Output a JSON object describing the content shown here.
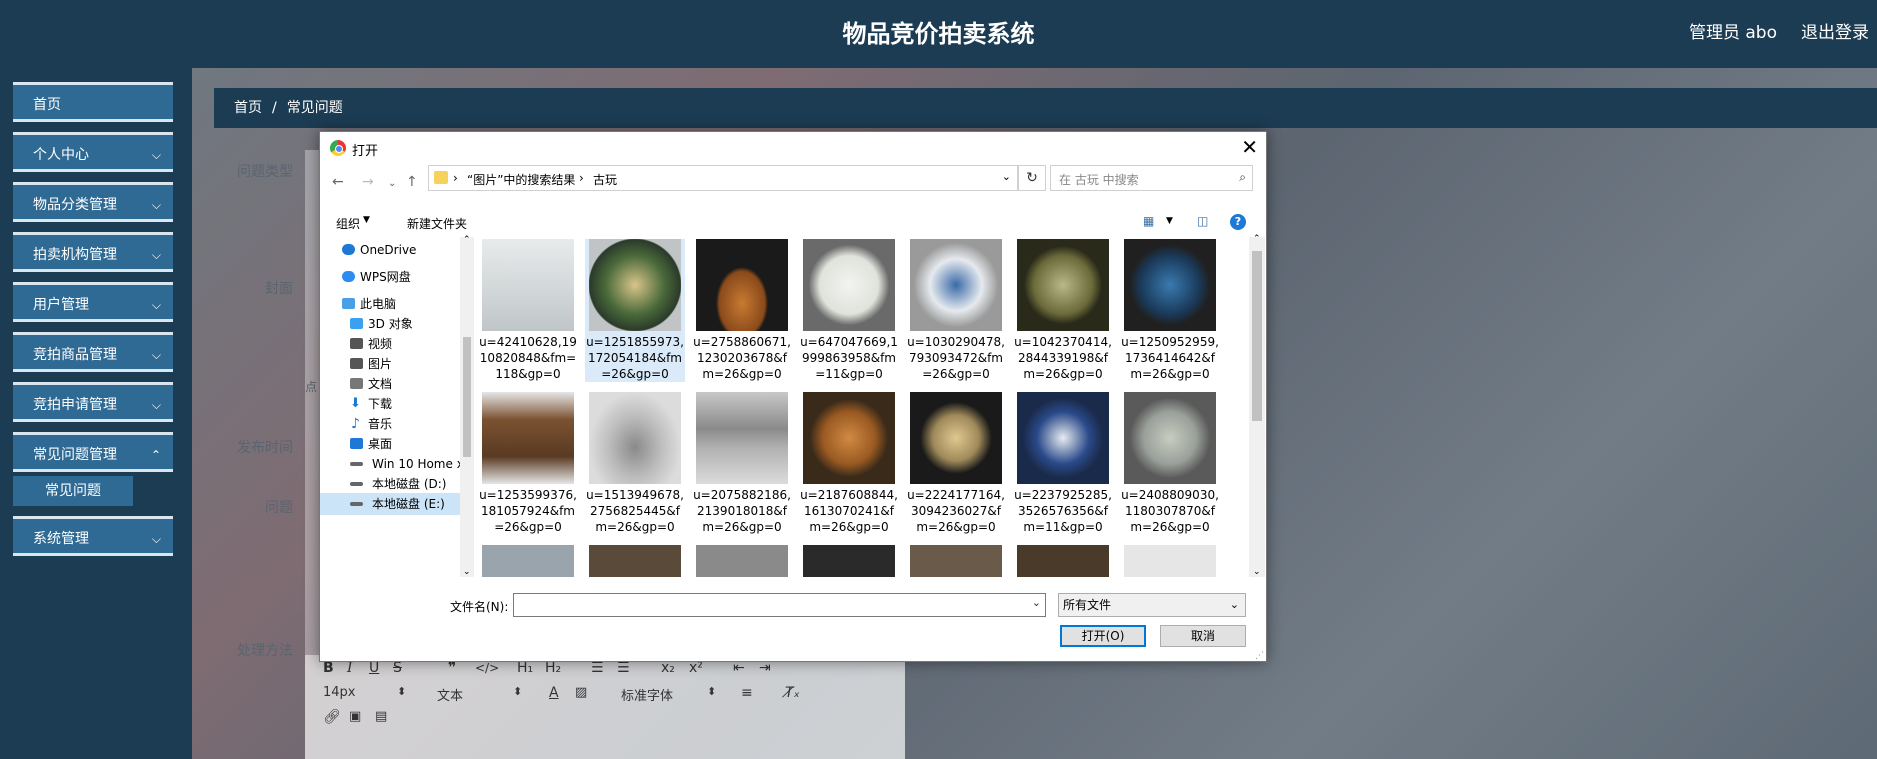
{
  "app": {
    "title": "物品竞价拍卖系统",
    "user": "管理员 abo",
    "logout": "退出登录"
  },
  "sidebar": {
    "items": [
      {
        "label": "首页",
        "chevron": false
      },
      {
        "label": "个人中心",
        "chevron": true
      },
      {
        "label": "物品分类管理",
        "chevron": true
      },
      {
        "label": "拍卖机构管理",
        "chevron": true
      },
      {
        "label": "用户管理",
        "chevron": true
      },
      {
        "label": "竞拍商品管理",
        "chevron": true
      },
      {
        "label": "竞拍申请管理",
        "chevron": true
      },
      {
        "label": "常见问题管理",
        "chevron": true
      },
      {
        "label": "系统管理",
        "chevron": true
      }
    ],
    "submenu": "常见问题"
  },
  "breadcrumb": {
    "home": "首页",
    "separator": "/",
    "current": "常见问题"
  },
  "form": {
    "labels": {
      "question_type": "问题类型",
      "cover": "封面",
      "cover_hint": "点",
      "publish_time": "发布时间",
      "question": "问题",
      "solution": "处理方法"
    },
    "editor": {
      "font_size": "14px",
      "paragraph": "文本",
      "font_family": "标准字体"
    }
  },
  "dialog": {
    "title": "打开",
    "path": [
      "“图片”中的搜索结果",
      "古玩"
    ],
    "search_placeholder": "在 古玩 中搜索",
    "organize": "组织",
    "new_folder": "新建文件夹",
    "nav_items": [
      {
        "label": "OneDrive",
        "icon": "cloud-icon",
        "color": "#1e78d6",
        "indent": 1
      },
      {
        "label": "WPS网盘",
        "icon": "cloud-icon",
        "color": "#2d8cf0",
        "indent": 1
      },
      {
        "label": "此电脑",
        "icon": "computer-icon",
        "color": "#4aa0e6",
        "indent": 1
      },
      {
        "label": "3D 对象",
        "icon": "cube-icon",
        "color": "#3aa0f0",
        "indent": 2
      },
      {
        "label": "视频",
        "icon": "video-icon",
        "color": "#555555",
        "indent": 2
      },
      {
        "label": "图片",
        "icon": "picture-icon",
        "color": "#555555",
        "indent": 2
      },
      {
        "label": "文档",
        "icon": "document-icon",
        "color": "#777777",
        "indent": 2
      },
      {
        "label": "下载",
        "icon": "download-icon",
        "color": "#1e78d6",
        "indent": 2
      },
      {
        "label": "音乐",
        "icon": "music-icon",
        "color": "#1e78d6",
        "indent": 2
      },
      {
        "label": "桌面",
        "icon": "desktop-icon",
        "color": "#1e78d6",
        "indent": 2
      },
      {
        "label": "Win 10 Home x",
        "icon": "drive-icon",
        "color": "#666666",
        "indent": 2
      },
      {
        "label": "本地磁盘 (D:)",
        "icon": "drive-icon",
        "color": "#666666",
        "indent": 2
      },
      {
        "label": "本地磁盘 (E:)",
        "icon": "drive-icon",
        "color": "#666666",
        "indent": 2,
        "selected": true
      }
    ],
    "files": [
      {
        "name": "u=42410628,1910820848&fm=118&gp=0",
        "color": "#d4d8da"
      },
      {
        "name": "u=1251855973,172054184&fm=26&gp=0",
        "color": "#567046",
        "selected": true
      },
      {
        "name": "u=2758860671,1230203678&fm=26&gp=0",
        "color": "#b36a2a"
      },
      {
        "name": "u=647047669,1999863958&fm=11&gp=0",
        "color": "#d6dad4"
      },
      {
        "name": "u=1030290478,793093472&fm=26&gp=0",
        "color": "#8aa0b8"
      },
      {
        "name": "u=1042370414,2844339198&fm=26&gp=0",
        "color": "#8a8a5a"
      },
      {
        "name": "u=1250952959,1736414642&fm=26&gp=0",
        "color": "#2a5a8a"
      },
      {
        "name": "u=1253599376,181057924&fm=26&gp=0",
        "color": "#7a5a3a"
      },
      {
        "name": "u=1513949678,2756825445&fm=26&gp=0",
        "color": "#9a9a9a"
      },
      {
        "name": "u=2075882186,2139018018&fm=26&gp=0",
        "color": "#8a8a8a"
      },
      {
        "name": "u=2187608844,1613070241&fm=26&gp=0",
        "color": "#b57a3a"
      },
      {
        "name": "u=2224177164,3094236027&fm=26&gp=0",
        "color": "#b09a6a"
      },
      {
        "name": "u=2237925285,3526576356&fm=11&gp=0",
        "color": "#2a4a8a"
      },
      {
        "name": "u=2408809030,1180307870&fm=26&gp=0",
        "color": "#9aa09a"
      }
    ],
    "filename_label": "文件名(N):",
    "filename_value": "",
    "filetype": "所有文件",
    "open_button": "打开(O)",
    "cancel_button": "取消"
  }
}
